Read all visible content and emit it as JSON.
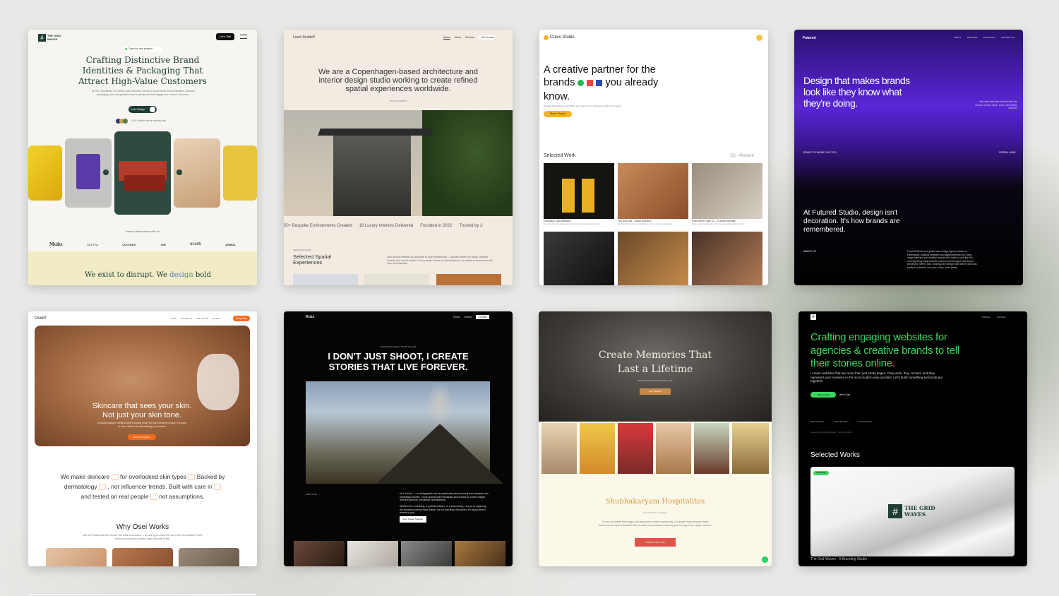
{
  "c1": {
    "logo": "THE GRID WAVES",
    "cta": "Let's Talk",
    "badge": "Open for new projects",
    "headline": "Crafting Distinctive Brand Identities & Packaging That Attract High-Value Customers",
    "sub": "At The Grid Waves, we partner with visionary brands to create iconic brand identities, standout packaging, and unforgettable brand experiences that engage and convert customers.",
    "design_btn": "Let's Design",
    "worked": "Brands that worked with us",
    "count_text": "100+ Brands we've worked with",
    "logos": [
      "Mubz",
      "TATTVA",
      "COCONUT",
      "VIM",
      "avanti",
      "ANMOL"
    ],
    "footer_pre": "We exist to disrupt. We",
    "footer_hl": "design",
    "footer_post": "bold"
  },
  "c2": {
    "logo": "Lucid Studio®",
    "nav": [
      "Works",
      "About",
      "Services",
      "Get in touch"
    ],
    "headline": "We are a Copenhagen-based architecture and interior design studio working to create refined spatial experiences worldwide.",
    "scroll": "scroll to explore",
    "stats": [
      "50+ Bespoke Environments Created",
      "18 Luxury Interiors Delivered",
      "Founded in 2022",
      "Trusted by 2"
    ],
    "kicker": "SELECTED WORK",
    "sel": "Selected Spatial Experiences",
    "para": "Each project reflects our approach to quiet architecture — spaces defined by clarity, material honesty and human rhythm. From private homes to cultural spaces, we shape environments with care and character."
  },
  "c3": {
    "logo": "Cravo Studio",
    "h1": "A creative partner for the",
    "h2": "brands",
    "h3": "you already",
    "h4": "know.",
    "sub": "We help brands figure out what to say, how to say it, and how to make it look good.",
    "cta": "Start a Project",
    "sel": "Selected Work",
    "years": "'22 - Present",
    "caps": [
      "Funkhaus Cola Rebrand",
      "The Soft Edit - Visual Direction",
      "Third Street Type Co. - Foundry Identity"
    ],
    "capsub": [
      "New identity and packaging system for an indie soda brand",
      "Art direction and visual guidelines for a skincare campaign",
      "Type specimen direction for an independent font foundry"
    ]
  },
  "c4": {
    "logo": "Futured",
    "nav": [
      "ABOUT",
      "SERVICES",
      "PORTFOLIO",
      "CONTACT US"
    ],
    "headline": "Design that makes brands look like they know what they're doing.",
    "side": "We build websites that feel like the obvious choice clean, bold, and built to convert.",
    "ready": "READY TO WORK? WE TOO.",
    "scroll": "SCROLL NOW",
    "about_text": "At Futured Studio, design isn't decoration. It's how brands are remembered.",
    "about_label": "ABOUT US",
    "about_para": "Futured Studio is a global web design agency based in Hyderabad, building websites and digital identities for early-stage startups and creative brands who want to look like the next big thing. Most brands sound cool but forget how they're perceived. We fix that. Strategy-led design that doesn't just look pretty, it converts. And yes, it also looks pretty."
  },
  "c5": {
    "logo": "Osei®",
    "nav": [
      "About",
      "Our Science",
      "Skin Journal",
      "Contact"
    ],
    "cta": "Shop Now",
    "headline": "Skincare that sees your skin. Not just your skin tone.",
    "sub": "Clinically-backed, melanin-safe formulas made for skin concerns unique to people of color. Backed by dermatology, not trends.",
    "hero_btn": "Get Your Regimen",
    "p1a": "We make skincare",
    "p1b": "for overlooked skin types",
    "p1c": "Backed by",
    "p2a": "dermatology",
    "p2b": ", not influencer trends.  Built with care in",
    "p3a": "and tested on real people",
    "p3b": "not assumptions.",
    "why": "Why Osei Works",
    "why_sub": "We don't follow skincare trends. We build what works — for skin types often left out of the conversation. Each product is made slow, tested right, and built to last."
  },
  "c6": {
    "logo": "Krizz",
    "nav": [
      "Home",
      "Gallery",
      "Contact"
    ],
    "kicker": "PHOTOGRAPHER & STORYTELLER",
    "headline": "I DON'T JUST SHOOT, I CREATE STORIES THAT LIVE FOREVER.",
    "about": "ABOUT ME",
    "p1": "Hi, I'm Krizz — a photographer who's passionate about turning real moments into meaningful stories. I work closely with individuals and brands to create images that feel genuine, emotional, and timeless.",
    "p2": "Whether it's a wedding, a portrait session, or a brand story, I focus on capturing the emotions behind every frame. It's not just about the photo, it's about what it means to you.",
    "btn": "Let's Create Together"
  },
  "c7": {
    "headline": "Create Memories That Last a Lifetime",
    "sub": "WEDDINGS, EVENTS, MORE • ETC",
    "cta": "LET'S BEGIN",
    "brand": "Shubhakaryam Hospitalites",
    "small": "OUR WORKS IN SIMPLE",
    "para": "To see our clients truly happy and stress-free on their special day. Our expert team ensures every detail of your event is handled with precision and perfection allowing you to enjoy every single moment.",
    "btn": "BOOK A CALL NOW"
  },
  "c8": {
    "nav": [
      "Portfolio",
      "Hire Now"
    ],
    "headline": "Crafting engaging websites for agencies & creative brands to tell their stories online.",
    "sub": "I create websites that are more than just pretty pages. They work, they convert, and they represent your business in the most modern way possible. Let's build something extraordinary together!",
    "btn1": "Book a Call",
    "btn2": "Let's Chat",
    "tags": [
      "Web Designer",
      "UI/UX Designer",
      "Framer Expert"
    ],
    "tagline": "Independent Web Designer · Driving Growth",
    "sel": "Selected Works",
    "badge": "Web Design",
    "brand": "THE GRID WAVES",
    "caption": "The Grid Waves - A Branding Studio"
  },
  "colors": {
    "green": "#3cd65e",
    "purple": "#7b2bf2",
    "orange": "#f26b1d",
    "coral": "#e0524a",
    "yellow": "#f5c542"
  }
}
